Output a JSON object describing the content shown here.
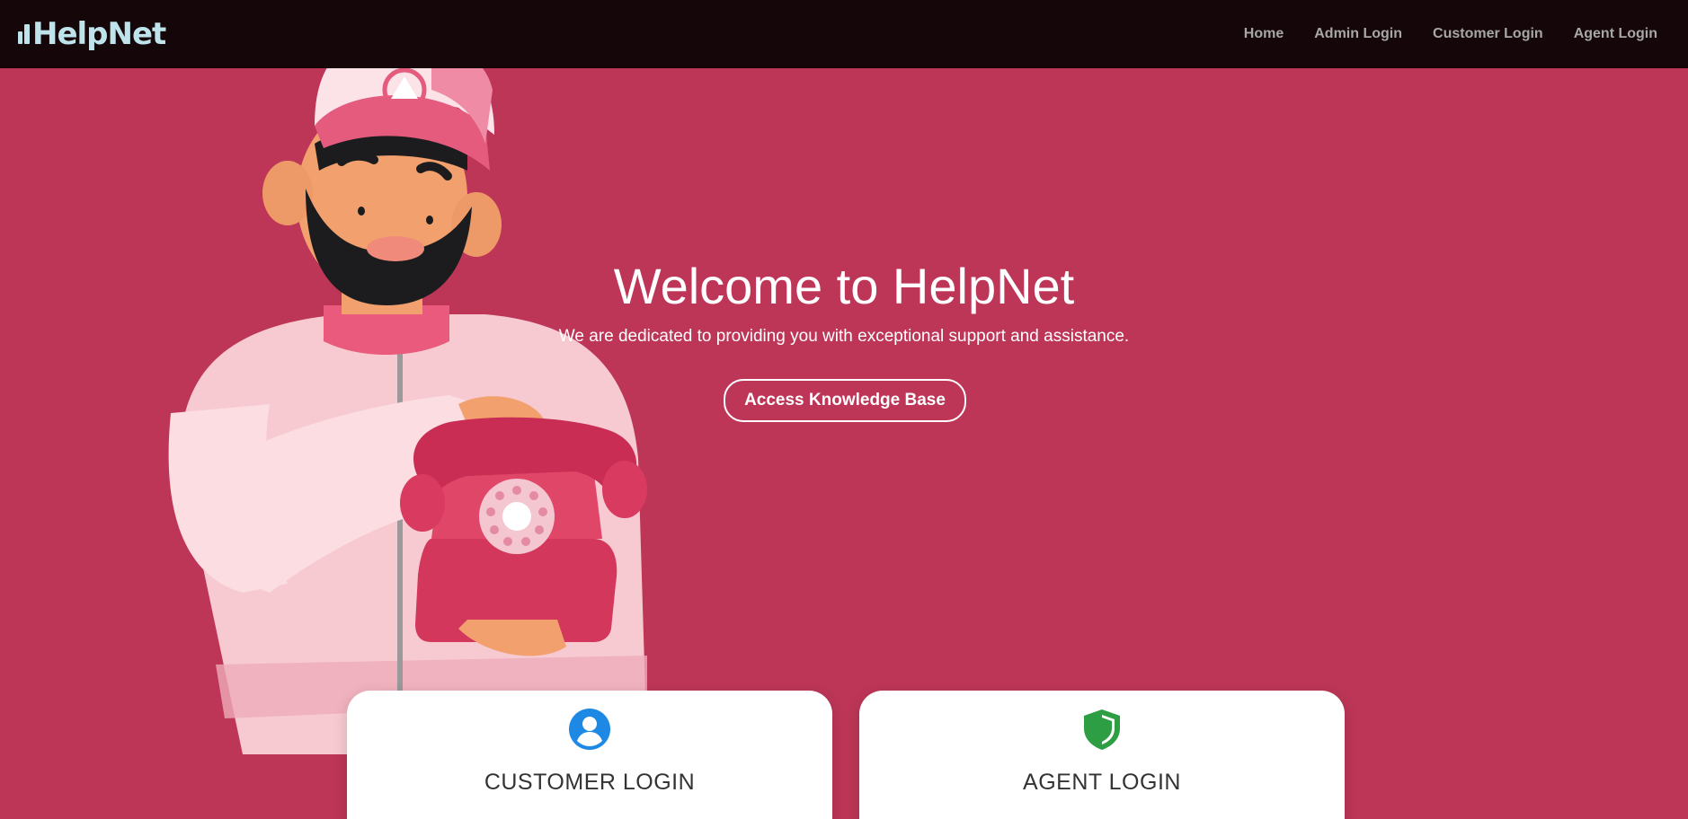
{
  "brand": {
    "logo_text": "HelpNet",
    "logo_color": "#bfe3ea"
  },
  "nav": {
    "items": [
      {
        "label": "Home"
      },
      {
        "label": "Admin Login"
      },
      {
        "label": "Customer Login"
      },
      {
        "label": "Agent Login"
      }
    ]
  },
  "hero": {
    "title": "Welcome to HelpNet",
    "subtitle": "We are dedicated to providing you with exceptional support and assistance.",
    "button_label": "Access Knowledge Base",
    "background_color": "#bd3657"
  },
  "cards": [
    {
      "title": "CUSTOMER LOGIN",
      "icon": "user-circle-icon",
      "icon_color": "#1e88e5",
      "text": ""
    },
    {
      "title": "AGENT LOGIN",
      "icon": "shield-icon",
      "icon_color": "#2e9e44",
      "text": ""
    }
  ]
}
